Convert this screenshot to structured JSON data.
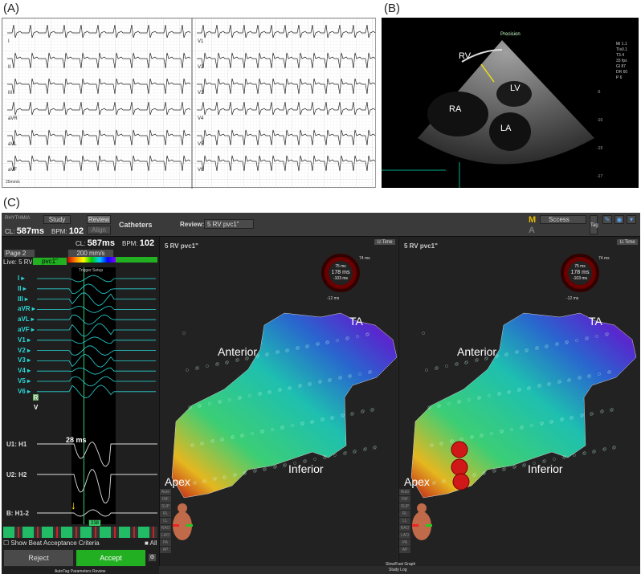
{
  "panels": {
    "a": "(A)",
    "b": "(B)",
    "c": "(C)"
  },
  "ecg": {
    "left_leads": [
      "I",
      "II",
      "III",
      "aVR",
      "aVL",
      "aVF"
    ],
    "right_leads": [
      "V1",
      "V2",
      "V3",
      "V4",
      "V5",
      "V6"
    ],
    "speed": "25mm/s"
  },
  "echo": {
    "labels": {
      "rv": "RV",
      "lv": "LV",
      "ra": "RA",
      "la": "LA"
    },
    "brand": "Precision",
    "side_info": [
      "Mi 1.1",
      "TIs0.1",
      "T3.4",
      "33 fps",
      "Gl 87",
      "DR 60",
      "P 6"
    ],
    "depth_marks": [
      "-5",
      "-10",
      "-15",
      "-17"
    ],
    "arrow_color": "#f5e600"
  },
  "app": {
    "logo": "RHYTHMIA",
    "study_label": "Study",
    "review_btn": "Review",
    "align_btn": "Align",
    "catheters": "Catheters",
    "review_label": "Review:",
    "review_value": "5 RV pvc1\"",
    "cl_label": "CL:",
    "cl_value": "587ms",
    "bpm_label": "BPM:",
    "bpm_value": "102",
    "page": "Page 2",
    "speed": "200 mm/s",
    "live_label": "Live: 5 RV",
    "live_value": "pvc1\"",
    "trigger_setup": "Trigger Setup",
    "lanes": [
      "I",
      "II",
      "III",
      "aVR",
      "aVL",
      "aVF",
      "V1",
      "V2",
      "V3",
      "V4",
      "V5",
      "V6"
    ],
    "lane_tags": {
      "r": "R",
      "v": "V"
    },
    "channels": [
      "U1: H1",
      "U2: H2",
      "B: H1-2"
    ],
    "interval": "28 ms",
    "window_marker": "238",
    "show_beat": "Show Beat Acceptance Criteria",
    "all": "All",
    "reject": "Reject",
    "accept": "Accept",
    "footer_left": "AutoTag Parameters Review",
    "footer_center": "Slow/Fast Graph",
    "footer_center2": "Study Log",
    "success_label": "Sccess",
    "m_letter": "M",
    "a_letter": "A",
    "tag": "Tag",
    "utime": "U.Time",
    "map_titles": [
      "5 RV pvc1\"",
      "5 RV pvc1\""
    ],
    "dial": {
      "top": "75 ms",
      "center": "178 ms",
      "bottom": "-103 ms",
      "right": "74 ms",
      "left": "-12 ms"
    },
    "map_labels": {
      "ta": "TA",
      "anterior": "Anterior",
      "inferior": "Inferior",
      "apex": "Apex"
    },
    "side_buttons": [
      "Auto",
      "INF",
      "SUP",
      "RL",
      "LL",
      "RAO",
      "LAO",
      "PA",
      "AP"
    ],
    "accept_color": "#22b022",
    "lane_color": "#29d6d6"
  }
}
